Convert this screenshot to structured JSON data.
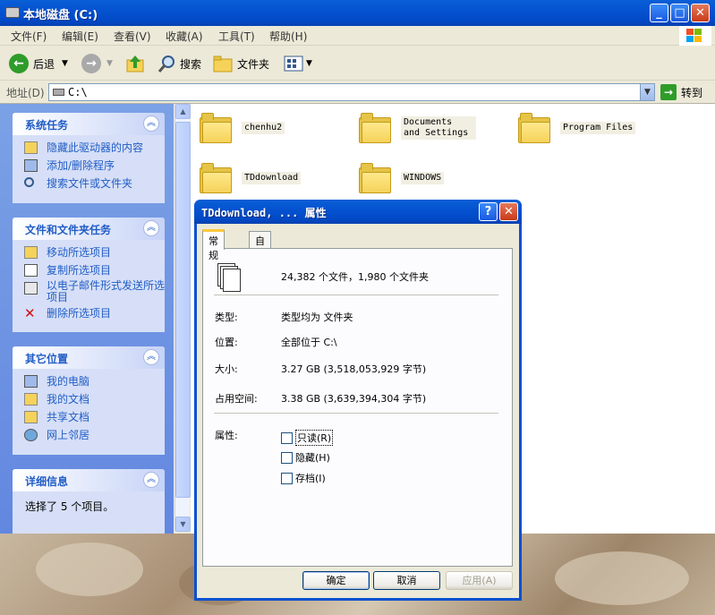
{
  "window": {
    "title": "本地磁盘 (C:)"
  },
  "menu": [
    "文件(F)",
    "编辑(E)",
    "查看(V)",
    "收藏(A)",
    "工具(T)",
    "帮助(H)"
  ],
  "toolbar": {
    "back_label": "后退",
    "search_label": "搜索",
    "folders_label": "文件夹"
  },
  "address": {
    "label": "地址(D)",
    "value": "C:\\",
    "go_label": "转到"
  },
  "sidebar": {
    "system_tasks": {
      "title": "系统任务",
      "items": [
        "隐藏此驱动器的内容",
        "添加/删除程序",
        "搜索文件或文件夹"
      ]
    },
    "file_tasks": {
      "title": "文件和文件夹任务",
      "items": [
        "移动所选项目",
        "复制所选项目",
        "以电子邮件形式发送所选项目",
        "删除所选项目"
      ]
    },
    "other_places": {
      "title": "其它位置",
      "items": [
        "我的电脑",
        "我的文档",
        "共享文档",
        "网上邻居"
      ]
    },
    "details": {
      "title": "详细信息",
      "text": "选择了 5 个项目。"
    }
  },
  "files": [
    {
      "name": "chenhu2"
    },
    {
      "name": "Documents and Settings"
    },
    {
      "name": "Program Files"
    },
    {
      "name": "TDdownload"
    },
    {
      "name": "WINDOWS"
    }
  ],
  "dialog": {
    "title": "TDdownload, ... 属性",
    "tabs": [
      "常规",
      "自定义"
    ],
    "summary": "24,382 个文件，1,980 个文件夹",
    "type_label": "类型:",
    "type_value": "类型均为 文件夹",
    "location_label": "位置:",
    "location_value": "全部位于 C:\\",
    "size_label": "大小:",
    "size_value": "3.27 GB (3,518,053,929 字节)",
    "disk_label": "占用空间:",
    "disk_value": "3.38 GB (3,639,394,304 字节)",
    "attrs_label": "属性:",
    "attrs": [
      "只读(R)",
      "隐藏(H)",
      "存档(I)"
    ],
    "ok": "确定",
    "cancel": "取消",
    "apply": "应用(A)"
  }
}
